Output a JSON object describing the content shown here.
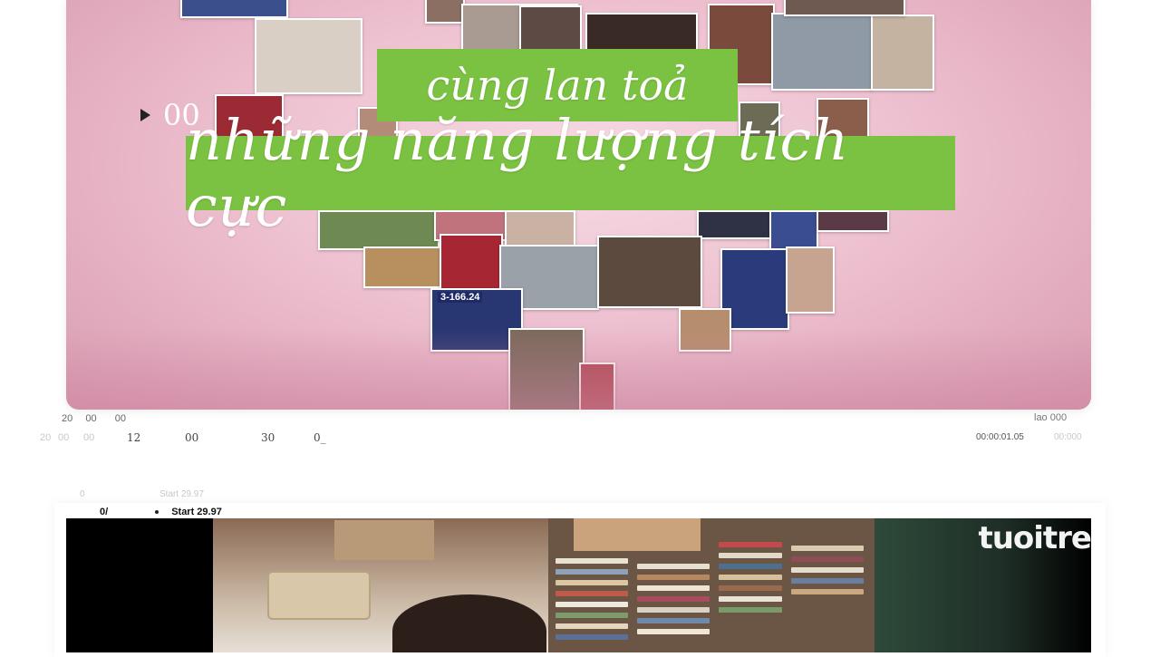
{
  "player1": {
    "banner_top": "cùng lan toả",
    "banner_main": "những năng lượng tích cực",
    "counter": "00",
    "tile_badge": "3-166.24"
  },
  "timeline_top": {
    "left_readout": [
      "20",
      "00",
      "00"
    ],
    "right_readout": "lao 000"
  },
  "timeline_ruler": {
    "ticks": [
      "20",
      "00",
      "00",
      "12",
      "00",
      "30",
      "0_"
    ],
    "timecode": "00:00:01.05",
    "timecode_faint": "00:000"
  },
  "marker_area": {
    "faint_zero": "0",
    "faint_start": "Start 29.97",
    "label_left": "0/",
    "start_label": "Start 29.97"
  },
  "player2": {
    "logo": "tuoitre"
  },
  "colors": {
    "banner_green": "#7cc242",
    "pink_bg": "#eec1d0"
  }
}
